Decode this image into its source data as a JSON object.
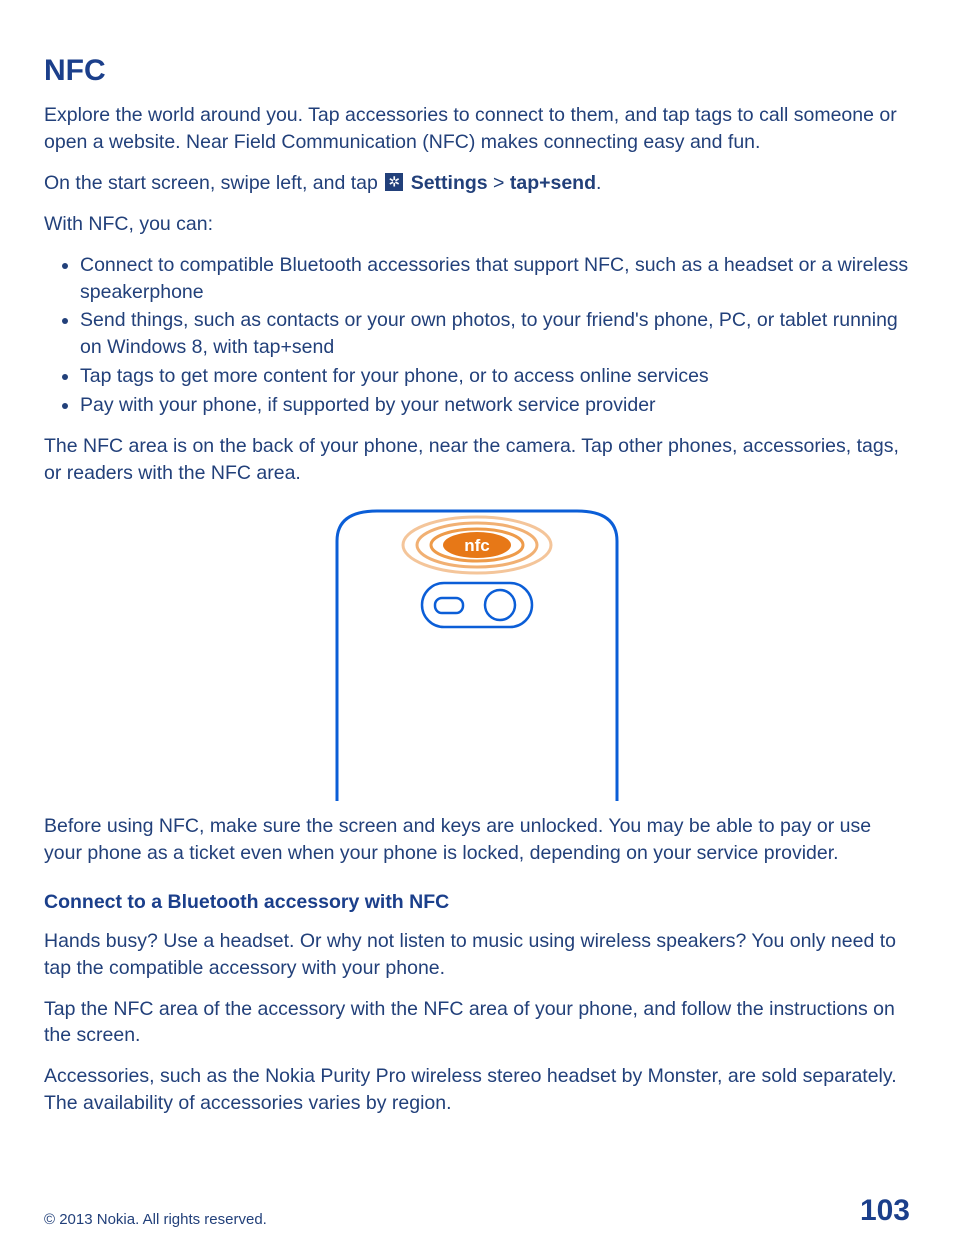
{
  "title": "NFC",
  "intro": "Explore the world around you. Tap accessories to connect to them, and tap tags to call someone or open a website. Near Field Communication (NFC) makes connecting easy and fun.",
  "instruction_pre": "On the start screen, swipe left, and tap ",
  "settings_label": "Settings",
  "separator": " > ",
  "tapsend_label": "tap+send",
  "instruction_post": ".",
  "withnfc": "With NFC, you can:",
  "bullets": {
    "b1": "Connect to compatible Bluetooth accessories that support NFC, such as a headset or a wireless speakerphone",
    "b2": "Send things, such as contacts or your own photos, to your friend's phone, PC, or tablet running on Windows 8, with tap+send",
    "b3": "Tap tags to get more content for your phone, or to access online services",
    "b4": "Pay with your phone, if supported by your network service provider"
  },
  "nfc_area": "The NFC area is on the back of your phone, near the camera. Tap other phones, accessories, tags, or readers with the NFC area.",
  "nfc_badge": "nfc",
  "before_using": "Before using NFC, make sure the screen and keys are unlocked. You may be able to pay or use your phone as a ticket even when your phone is locked, depending on your service provider.",
  "section2_title": "Connect to a Bluetooth accessory with NFC",
  "section2_p1": "Hands busy? Use a headset. Or why not listen to music using wireless speakers? You only need to tap the compatible accessory with your phone.",
  "section2_p2": "Tap the NFC area of the accessory with the NFC area of your phone, and follow the instructions on the screen.",
  "section2_p3": "Accessories, such as the Nokia Purity Pro wireless stereo headset by Monster, are sold separately. The availability of accessories varies by region.",
  "copyright": "© 2013 Nokia. All rights reserved.",
  "page_number": "103"
}
